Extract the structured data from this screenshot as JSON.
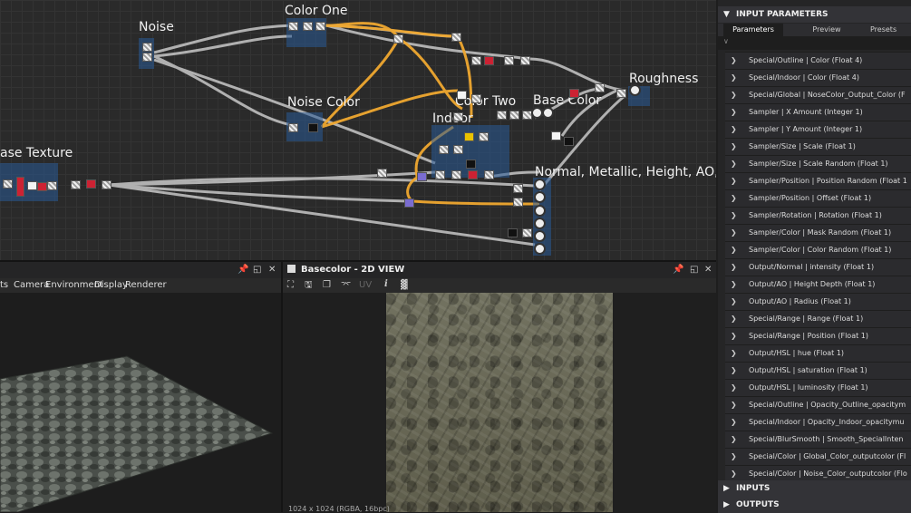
{
  "graph": {
    "frames": {
      "noise": "Noise",
      "color_one": "Color One",
      "noise_color": "Noise Color",
      "indoor": "Indoor",
      "color_two": "Color Two",
      "base_color": "Base Color",
      "roughness": "Roughness",
      "base_texture": "ase Texture",
      "normal_group": "Normal, Metallic, Height, AO, C"
    }
  },
  "view3d": {
    "tabs": [
      "ts",
      "Camera",
      "Environment",
      "Display",
      "Renderer"
    ]
  },
  "view2d": {
    "title": "Basecolor - 2D VIEW",
    "uv_label": "UV",
    "info_icon": "i",
    "status": "1024 x 1024 (RGBA, 16bpc)"
  },
  "right_panel": {
    "header": "INPUT PARAMETERS",
    "tabs": [
      "Parameters",
      "Preview",
      "Presets"
    ],
    "params": [
      "Special/Outline | Color (Float 4)",
      "Special/Indoor | Color (Float 4)",
      "Special/Global | NoseColor_Output_Color (F",
      "Sampler | X Amount (Integer 1)",
      "Sampler | Y Amount (Integer 1)",
      "Sampler/Size | Scale (Float 1)",
      "Sampler/Size | Scale Random (Float 1)",
      "Sampler/Position | Position Random (Float 1",
      "Sampler/Position | Offset (Float 1)",
      "Sampler/Rotation | Rotation (Float 1)",
      "Sampler/Color | Mask Random (Float 1)",
      "Sampler/Color | Color Random (Float 1)",
      "Output/Normal | intensity (Float 1)",
      "Output/AO | Height Depth (Float 1)",
      "Output/AO | Radius (Float 1)",
      "Special/Range | Range (Float 1)",
      "Special/Range | Position (Float 1)",
      "Output/HSL | hue (Float 1)",
      "Output/HSL | saturation (Float 1)",
      "Output/HSL | luminosity (Float 1)",
      "Special/Outline | Opacity_Outline_opacitym",
      "Special/Indoor | Opacity_Indoor_opacitymu",
      "Special/BlurSmooth | Smooth_SpecialInten",
      "Special/Color | Global_Color_outputcolor (Fl",
      "Special/Color | Noise_Color_outputcolor (Flo"
    ],
    "inputs": "INPUTS",
    "outputs": "OUTPUTS"
  },
  "icons": {
    "pin": "pin-icon",
    "maximize": "maximize-icon",
    "close": "close-icon"
  }
}
